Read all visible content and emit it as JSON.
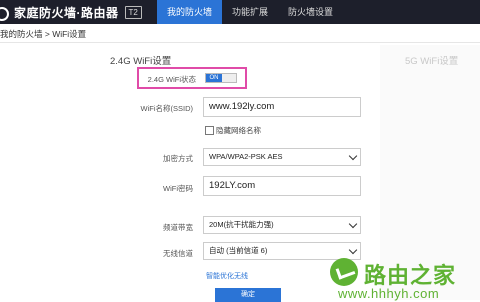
{
  "header": {
    "brand": "家庭防火墙·路由器",
    "model_badge": "T2",
    "tabs": [
      {
        "label": "我的防火墙",
        "active": true
      },
      {
        "label": "功能扩展",
        "active": false
      },
      {
        "label": "防火墙设置",
        "active": false
      }
    ]
  },
  "breadcrumb": "我的防火墙 > WiFi设置",
  "wifi_24": {
    "title": "2.4G WiFi设置",
    "status_label": "2.4G WiFi状态",
    "status_toggle": "ON",
    "ssid_label": "WiFi名称(SSID)",
    "ssid_value": "www.192ly.com",
    "hide_ssid_label": "隐藏网络名称",
    "encryption_label": "加密方式",
    "encryption_value": "WPA/WPA2-PSK AES",
    "password_label": "WiFi密码",
    "password_value": "192LY.com",
    "bandwidth_label": "频道带宽",
    "bandwidth_value": "20M(抗干扰能力强)",
    "channel_label": "无线信道",
    "channel_value": "自动 (当前信道 6)",
    "optimize_link": "智能优化无线",
    "confirm_button": "确定"
  },
  "wifi_5g": {
    "title": "5G WiFi设置"
  },
  "watermark": {
    "title": "路由之家",
    "url": "www.hhhyh.com"
  },
  "colors": {
    "topbar": "#1d1f2b",
    "accent": "#2b74d6",
    "highlight": "#e04ba8",
    "watermark": "#5fb233"
  }
}
